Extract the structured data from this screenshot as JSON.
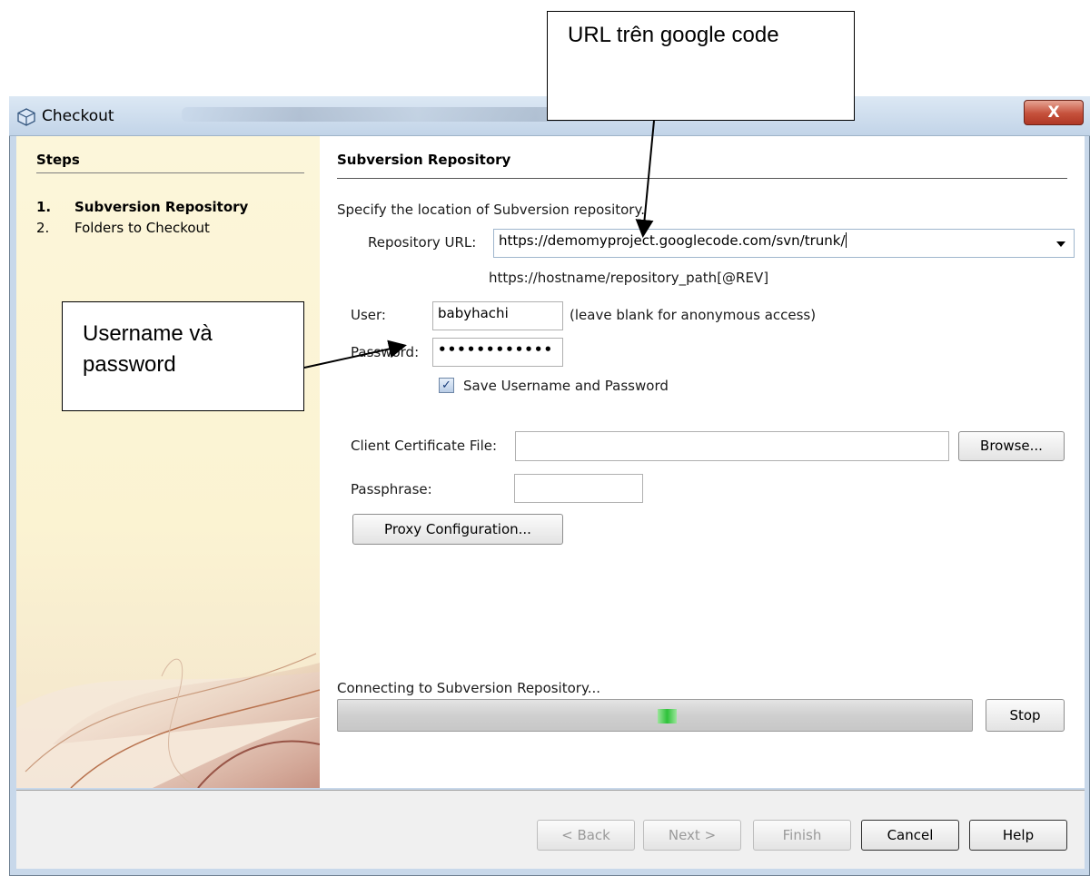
{
  "window": {
    "title": "Checkout",
    "close_label": "X"
  },
  "steps_panel": {
    "heading": "Steps",
    "items": [
      {
        "number": "1.",
        "label": "Subversion Repository",
        "active": true
      },
      {
        "number": "2.",
        "label": "Folders to Checkout",
        "active": false
      }
    ]
  },
  "main": {
    "heading": "Subversion Repository",
    "description": "Specify the location of Subversion repository.",
    "repository_url_label": "Repository URL:",
    "repository_url_value": "https://demomyproject.googlecode.com/svn/trunk/",
    "url_hint": "https://hostname/repository_path[@REV]",
    "user_label": "User:",
    "user_value": "babyhachi",
    "user_hint": "(leave blank for anonymous access)",
    "password_label": "Password:",
    "password_value": "••••••••••••",
    "save_checkbox_label": "Save Username and Password",
    "save_checked": true,
    "client_cert_label": "Client Certificate File:",
    "client_cert_value": "",
    "browse_label": "Browse...",
    "passphrase_label": "Passphrase:",
    "passphrase_value": "",
    "proxy_label": "Proxy Configuration...",
    "status_text": "Connecting to Subversion Repository...",
    "progress_fraction": 0.52,
    "stop_label": "Stop"
  },
  "footer": {
    "back_label": "< Back",
    "next_label": "Next >",
    "finish_label": "Finish",
    "cancel_label": "Cancel",
    "help_label": "Help"
  },
  "annotations": {
    "url_note": "URL trên google code",
    "user_note_line1": "Username và",
    "user_note_line2": "password"
  },
  "colors": {
    "title_bar": "#c2d4e8",
    "close_button": "#c5503b",
    "steps_panel_bg": "#fbf3d2",
    "progress_fill": "#2ec23a"
  }
}
